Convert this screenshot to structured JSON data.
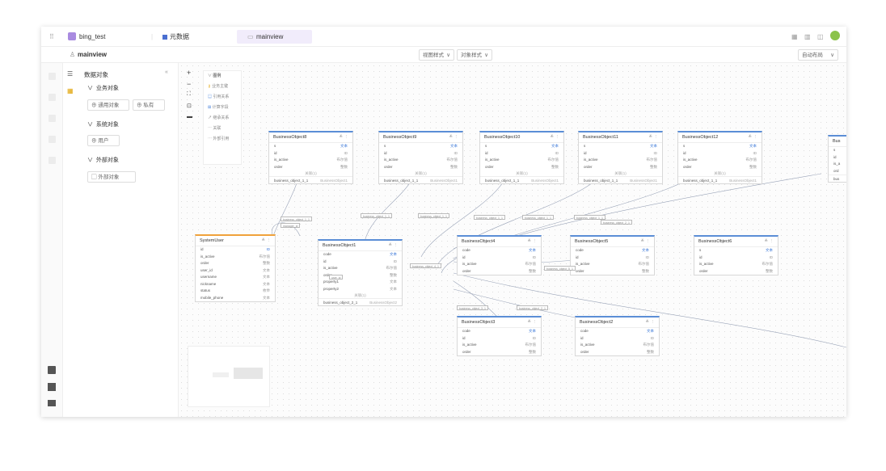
{
  "topbar": {
    "project": "bing_test",
    "tab_db": "元数据",
    "tab_main": "mainview"
  },
  "subbar": {
    "title": "mainview",
    "view_style": "视图样式",
    "obj_style": "对象样式",
    "auto_layout": "自动布局"
  },
  "panel": {
    "title": "数据对象",
    "group_biz": "业务对象",
    "btn_common": "通用对象",
    "btn_private": "私有",
    "group_sys": "系统对象",
    "item_user": "用户",
    "group_ext": "外部对象",
    "item_ext": "外部对象"
  },
  "legend": {
    "title": "图例",
    "pk": "业务主键",
    "rel": "引用关系",
    "calc": "计算字段",
    "ref": "继承关系",
    "link1": "关联",
    "link2": "外部引用"
  },
  "cards": [
    {
      "title": "BusinessObject8",
      "rows": [
        [
          "s",
          "文本"
        ],
        [
          "id",
          "ID"
        ],
        [
          "is_active",
          "布尔值"
        ],
        [
          "order",
          "整数"
        ]
      ],
      "mid": "关联(1)",
      "rel": [
        "business_object_1_1",
        "BusinessObject1"
      ]
    },
    {
      "title": "BusinessObject9",
      "rows": [
        [
          "s",
          "文本"
        ],
        [
          "id",
          "ID"
        ],
        [
          "is_active",
          "布尔值"
        ],
        [
          "order",
          "整数"
        ]
      ],
      "mid": "关联(1)",
      "rel": [
        "business_object_1_1",
        "BusinessObject1"
      ]
    },
    {
      "title": "BusinessObject10",
      "rows": [
        [
          "s",
          "文本"
        ],
        [
          "id",
          "ID"
        ],
        [
          "is_active",
          "布尔值"
        ],
        [
          "order",
          "整数"
        ]
      ],
      "mid": "关联(1)",
      "rel": [
        "business_object_1_1",
        "BusinessObject1"
      ]
    },
    {
      "title": "BusinessObject11",
      "rows": [
        [
          "s",
          "文本"
        ],
        [
          "id",
          "ID"
        ],
        [
          "is_active",
          "布尔值"
        ],
        [
          "order",
          "整数"
        ]
      ],
      "mid": "关联(1)",
      "rel": [
        "business_object_1_1",
        "BusinessObject1"
      ]
    },
    {
      "title": "BusinessObject12",
      "rows": [
        [
          "s",
          "文本"
        ],
        [
          "id",
          "ID"
        ],
        [
          "is_active",
          "布尔值"
        ],
        [
          "order",
          "整数"
        ]
      ],
      "mid": "关联(1)",
      "rel": [
        "business_object_1_1",
        "BusinessObject1"
      ]
    },
    {
      "title": "SystemUser",
      "rows": [
        [
          "id",
          "ID"
        ],
        [
          "is_active",
          "布尔值"
        ],
        [
          "order",
          "整数"
        ],
        [
          "user_id",
          "文本"
        ],
        [
          "username",
          "文本"
        ],
        [
          "nickname",
          "文本"
        ],
        [
          "status",
          "枚举"
        ],
        [
          "mobile_phone",
          "文本"
        ]
      ],
      "mid": "",
      "rel": [
        "",
        ""
      ]
    },
    {
      "title": "BusinessObject1",
      "rows": [
        [
          "code",
          "文本"
        ],
        [
          "id",
          "ID"
        ],
        [
          "is_active",
          "布尔值"
        ],
        [
          "order",
          "整数"
        ],
        [
          "property1",
          "文本"
        ],
        [
          "property2",
          "文本"
        ]
      ],
      "mid": "关联(1)",
      "rel": [
        "business_object_2_1",
        "BusinessObject2"
      ]
    },
    {
      "title": "BusinessObject4",
      "rows": [
        [
          "code",
          "文本"
        ],
        [
          "id",
          "ID"
        ],
        [
          "is_active",
          "布尔值"
        ],
        [
          "order",
          "整数"
        ]
      ],
      "mid": "",
      "rel": [
        "",
        ""
      ]
    },
    {
      "title": "BusinessObject5",
      "rows": [
        [
          "code",
          "文本"
        ],
        [
          "id",
          "ID"
        ],
        [
          "is_active",
          "布尔值"
        ],
        [
          "order",
          "整数"
        ]
      ],
      "mid": "",
      "rel": [
        "",
        ""
      ]
    },
    {
      "title": "BusinessObject6",
      "rows": [
        [
          "s",
          "文本"
        ],
        [
          "id",
          "ID"
        ],
        [
          "is_active",
          "布尔值"
        ],
        [
          "order",
          "整数"
        ]
      ],
      "mid": "",
      "rel": [
        "",
        ""
      ]
    },
    {
      "title": "BusinessObject3",
      "rows": [
        [
          "code",
          "文本"
        ],
        [
          "id",
          "ID"
        ],
        [
          "is_active",
          "布尔值"
        ],
        [
          "order",
          "整数"
        ]
      ],
      "mid": "",
      "rel": [
        "",
        ""
      ]
    },
    {
      "title": "BusinessObject2",
      "rows": [
        [
          "code",
          "文本"
        ],
        [
          "id",
          "ID"
        ],
        [
          "is_active",
          "布尔值"
        ],
        [
          "order",
          "整数"
        ]
      ],
      "mid": "",
      "rel": [
        "",
        ""
      ]
    },
    {
      "title": "Bus",
      "rows": [
        [
          "s",
          ""
        ],
        [
          "id",
          ""
        ],
        [
          "is_a",
          ""
        ],
        [
          "ord",
          ""
        ]
      ],
      "mid": "",
      "rel": [
        "bus",
        ""
      ]
    }
  ],
  "edge_labels": [
    "business_object_1_1",
    "business_object_1_1",
    "business_object_1_1",
    "business_object_1_1",
    "business_object_1_1",
    "business_object_1_1",
    "business_object_2_1",
    "business_object_4_1",
    "business_object_5_1",
    "business_object_3_1",
    "business_object_2_1",
    "user_id",
    "manager_id"
  ]
}
